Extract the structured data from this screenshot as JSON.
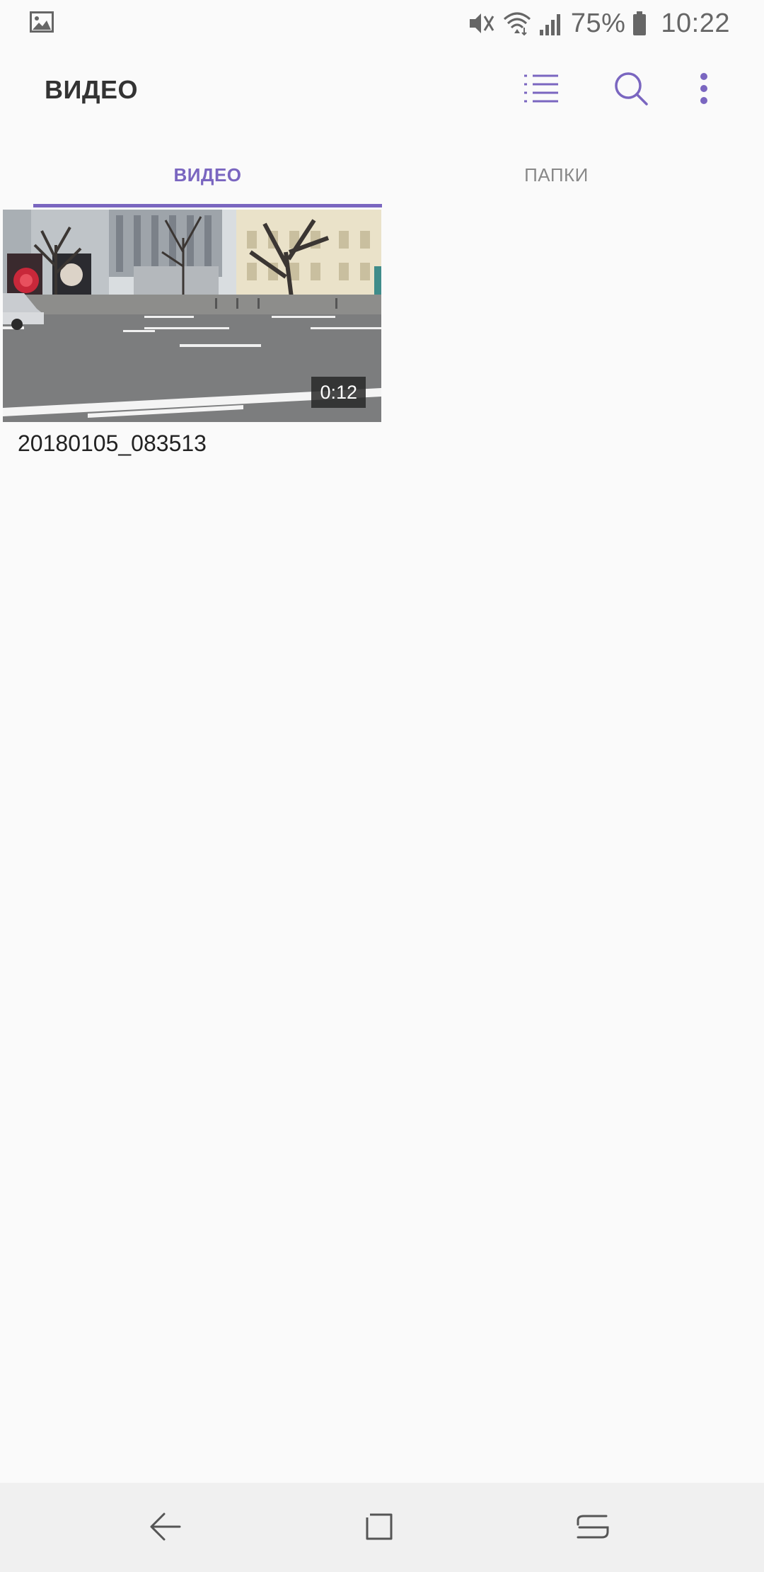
{
  "status_bar": {
    "battery": "75%",
    "time": "10:22"
  },
  "toolbar": {
    "title": "ВИДЕО"
  },
  "tabs": [
    {
      "label": "ВИДЕО",
      "selected": true
    },
    {
      "label": "ПАПКИ",
      "selected": false
    }
  ],
  "videos": [
    {
      "name": "20180105_083513",
      "duration": "0:12"
    }
  ],
  "colors": {
    "accent": "#7a66c0",
    "background": "#fafafa",
    "nav_background": "#f0f0f0"
  },
  "icons": {
    "status_left": "gallery-icon",
    "status_right": [
      "mute-icon",
      "wifi-icon",
      "signal-icon",
      "battery-icon"
    ],
    "toolbar": [
      "view-list-icon",
      "search-icon",
      "more-vert-icon"
    ],
    "nav": [
      "back-icon",
      "home-icon",
      "recents-icon"
    ]
  }
}
